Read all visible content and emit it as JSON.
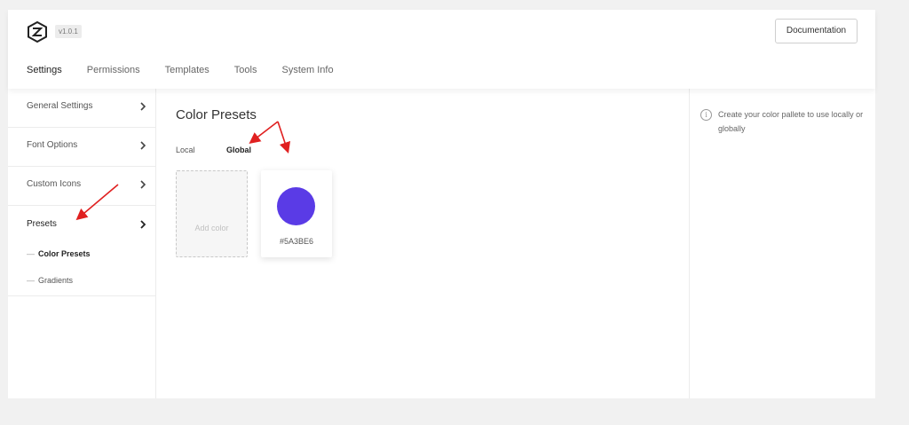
{
  "header": {
    "version": "v1.0.1",
    "documentation_label": "Documentation",
    "logo_icon": "brand-logo-icon"
  },
  "nav": {
    "tabs": [
      {
        "label": "Settings",
        "active": true
      },
      {
        "label": "Permissions",
        "active": false
      },
      {
        "label": "Templates",
        "active": false
      },
      {
        "label": "Tools",
        "active": false
      },
      {
        "label": "System Info",
        "active": false
      }
    ]
  },
  "sidebar": {
    "items": [
      {
        "label": "General Settings",
        "icon": "chevron-right-icon"
      },
      {
        "label": "Font Options",
        "icon": "chevron-right-icon"
      },
      {
        "label": "Custom Icons",
        "icon": "chevron-right-icon"
      },
      {
        "label": "Presets",
        "icon": "chevron-right-icon"
      }
    ],
    "sub_items": [
      {
        "label": "Color Presets",
        "active": true
      },
      {
        "label": "Gradients",
        "active": false
      }
    ],
    "sub_dash": "—"
  },
  "main": {
    "title": "Color Presets",
    "scope_tabs": [
      {
        "label": "Local",
        "active": false
      },
      {
        "label": "Global",
        "active": true
      }
    ],
    "add_color_label": "Add color",
    "swatches": [
      {
        "hex": "#5A3BE6",
        "color": "#5a3be6"
      }
    ]
  },
  "info": {
    "icon": "info-circle-icon",
    "icon_glyph": "i",
    "text": "Create your color pallete to use locally or globally"
  },
  "colors": {
    "annotation_arrow": "#e02020",
    "swatch": "#5a3be6"
  }
}
